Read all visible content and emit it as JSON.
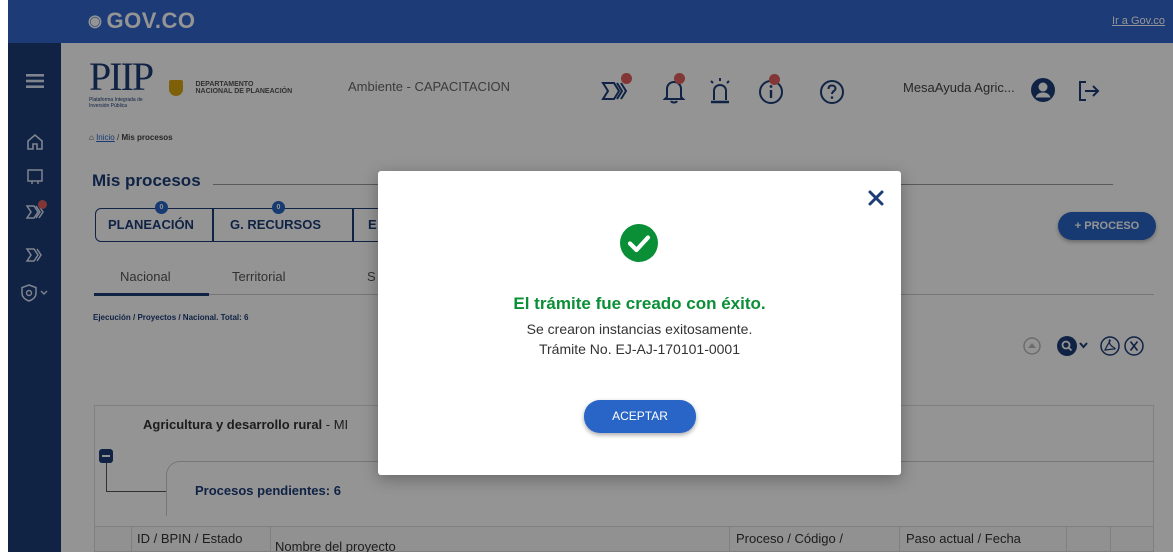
{
  "gov_bar": {
    "logo_text": "GOV.CO",
    "link": "Ir a Gov.co"
  },
  "sidebar": {
    "items": [
      {
        "icon": "menu-icon"
      },
      {
        "icon": "home-icon"
      },
      {
        "icon": "projects-icon"
      },
      {
        "icon": "process-icon",
        "badge": ""
      },
      {
        "icon": "flow-icon"
      },
      {
        "icon": "shield-icon"
      }
    ]
  },
  "header": {
    "app_logo": "PIIP",
    "app_logo_sub": "Plataforma Integrada de Inversión Pública",
    "org_name_line1": "DEPARTAMENTO",
    "org_name_line2": "NACIONAL DE PLANEACIÓN",
    "environment": "Ambiente - CAPACITACION",
    "user": "MesaAyuda Agric...",
    "toolbar_icons": [
      "process-flow-icon",
      "bell-icon",
      "alarm-icon",
      "info-icon",
      "help-icon"
    ]
  },
  "breadcrumb": {
    "home": "Inicio",
    "separator": "/",
    "current": "Mis procesos"
  },
  "page_title": "Mis procesos",
  "stepper": {
    "steps": [
      {
        "label": "PLANEACIÓN",
        "count": "0"
      },
      {
        "label": "G. RECURSOS",
        "count": "0"
      },
      {
        "label": "E"
      }
    ]
  },
  "new_process_button": "+ PROCESO",
  "tabs": [
    "Nacional",
    "Territorial",
    "S"
  ],
  "results_summary": "Ejecución / Proyectos / Nacional. Total: 6",
  "group": {
    "title": "Agricultura y desarrollo rural",
    "suffix": " - MI",
    "pending": "Procesos pendientes: 6"
  },
  "table": {
    "headers": [
      "ID / BPIN / Estado",
      "Nombre del proyecto",
      "Proceso / Código /",
      "Paso actual / Fecha"
    ]
  },
  "modal": {
    "title": "El trámite fue creado con éxito.",
    "line1": "Se crearon instancias exitosamente.",
    "line2": "Trámite No. EJ-AJ-170101-0001",
    "accept_button": "ACEPTAR"
  },
  "colors": {
    "gov_blue": "#3366cc",
    "sidebar_navy": "#1c3d78",
    "primary": "#2965c6",
    "success_green": "#0a8f36",
    "badge_red": "#e25d5d"
  }
}
